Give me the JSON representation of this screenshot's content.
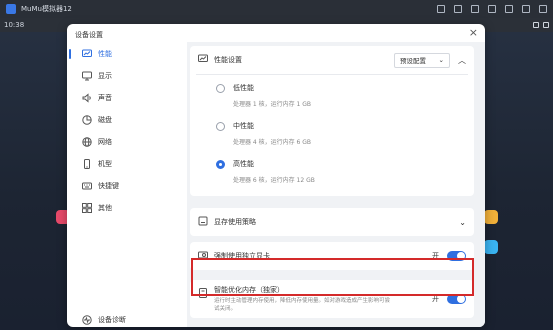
{
  "window": {
    "title": "MuMu模拟器12"
  },
  "status": {
    "time": "10:38"
  },
  "dialog": {
    "title": "设备设置",
    "close": "×",
    "nav": [
      {
        "label": "性能",
        "icon": "monitor-icon"
      },
      {
        "label": "显示",
        "icon": "display-icon"
      },
      {
        "label": "声音",
        "icon": "speaker-icon"
      },
      {
        "label": "磁盘",
        "icon": "disk-icon"
      },
      {
        "label": "网络",
        "icon": "globe-icon"
      },
      {
        "label": "机型",
        "icon": "phone-icon"
      },
      {
        "label": "快捷键",
        "icon": "keyboard-icon"
      },
      {
        "label": "其他",
        "icon": "grid-icon"
      }
    ],
    "footer": {
      "label": "设备诊断"
    },
    "performance": {
      "title": "性能设置",
      "preset": "预设配置",
      "options": [
        {
          "label": "低性能",
          "desc": "处理器 1 核，运行内存 1 GB",
          "checked": false
        },
        {
          "label": "中性能",
          "desc": "处理器 4 核，运行内存 6 GB",
          "checked": false
        },
        {
          "label": "高性能",
          "desc": "处理器 6 核，运行内存 12 GB",
          "checked": true
        }
      ]
    },
    "vram": {
      "title": "显存使用策略"
    },
    "gpu": {
      "title": "强制使用独立显卡",
      "state": "开"
    },
    "smart_memory": {
      "title": "智能优化内存（独家）",
      "desc": "运行时主动管理内存使用，降低内存使用量。如对游戏造成产生影响可尝试关闭。",
      "state": "开"
    }
  },
  "colors": {
    "accent": "#2f6fe0",
    "highlight": "#d42a2a"
  }
}
